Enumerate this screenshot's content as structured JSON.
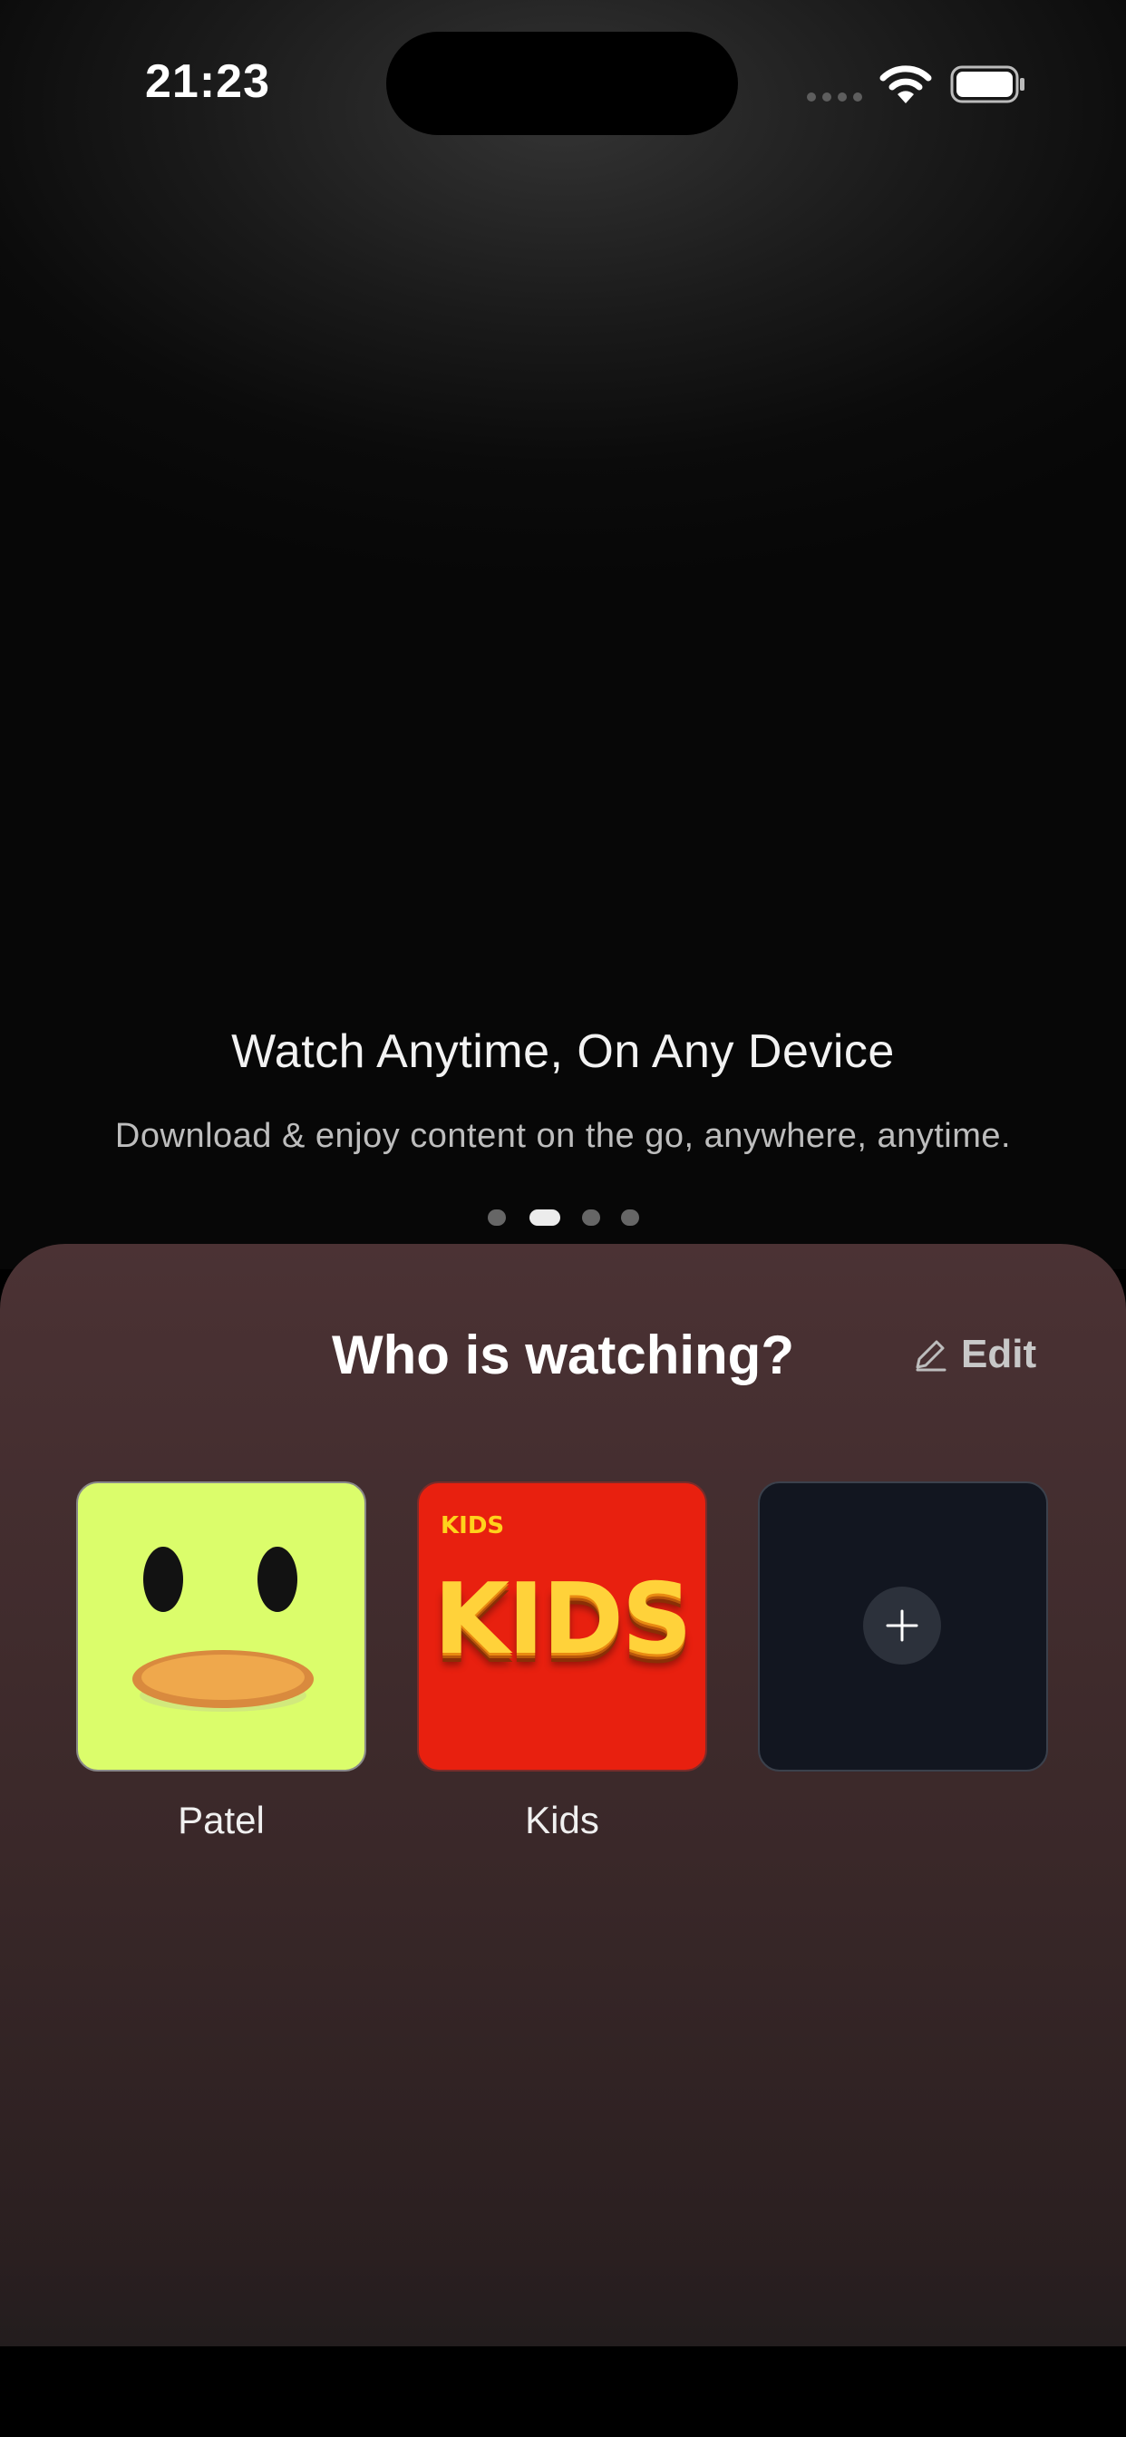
{
  "status_bar": {
    "time": "21:23",
    "icons": [
      "cellular-signal-icon",
      "wifi-icon",
      "battery-icon"
    ]
  },
  "hero": {
    "title": "Watch Anytime, On Any Device",
    "subtitle": "Download & enjoy content on the go, anywhere, anytime.",
    "carousel": {
      "pages": 4,
      "active_index": 1
    }
  },
  "profile_sheet": {
    "title": "Who is watching?",
    "edit_label": "Edit",
    "edit_icon": "pencil-icon",
    "profiles": [
      {
        "name": "Patel",
        "avatar": "duck-face-avatar"
      },
      {
        "name": "Kids",
        "avatar": "kids-logo-avatar",
        "avatar_text_small": "KIDS",
        "avatar_text_large": "KIDS"
      }
    ],
    "add_profile_icon": "plus-icon"
  },
  "colors": {
    "sheet_top": "#4b3234",
    "sheet_bottom": "#231d1e",
    "duck_avatar_bg": "#dbfd6b",
    "kids_avatar_bg": "#e8200f",
    "add_tile_bg": "#121620",
    "active_dot": "#ececec",
    "inactive_dot": "#666666"
  }
}
